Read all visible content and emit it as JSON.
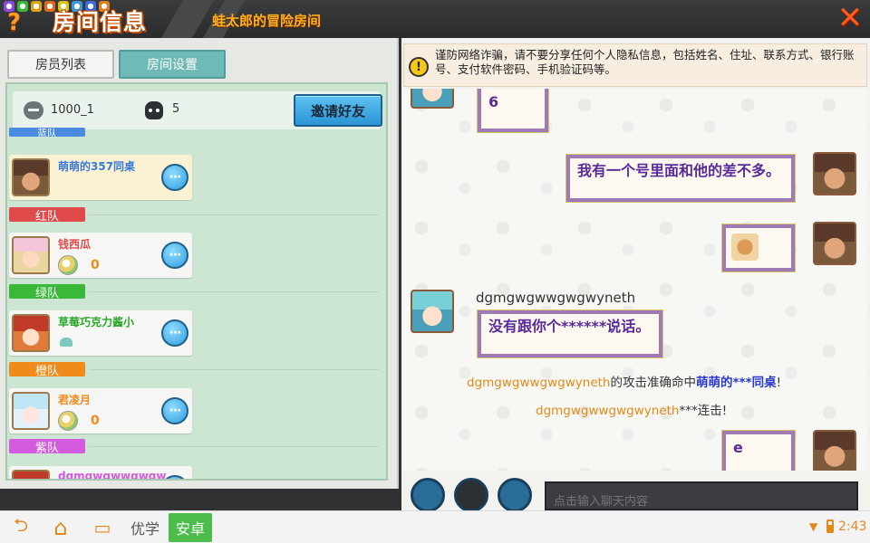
{
  "header": {
    "title": "房间信息",
    "subtitle": "蛙太郎的冒险房间",
    "help_glyph": "?",
    "close_glyph": "✕"
  },
  "tabs": [
    {
      "label": "房员列表",
      "active": true
    },
    {
      "label": "房间设置",
      "active": false
    }
  ],
  "room": {
    "id": "1000_1",
    "player_count": "5",
    "invite_label": "邀请好友"
  },
  "teams": [
    {
      "label": "蓝队",
      "color": "#4a8ae0"
    },
    {
      "label": "红队",
      "color": "#e04a4a"
    },
    {
      "label": "绿队",
      "color": "#3ab83a"
    },
    {
      "label": "橙队",
      "color": "#f08a1a"
    },
    {
      "label": "紫队",
      "color": "#d45ae0"
    }
  ],
  "members": [
    {
      "name": "萌萌的357同桌",
      "name_color": "#3a7ad8",
      "score": "",
      "has_score": false
    },
    {
      "name": "钱西瓜",
      "name_color": "#e04a4a",
      "score": "0",
      "has_score": true
    },
    {
      "name": "草莓巧克力酱小",
      "name_color": "#2aa82a",
      "score": "",
      "has_score": false
    },
    {
      "name": "君凌月",
      "name_color": "#f08a1a",
      "score": "0",
      "has_score": true
    },
    {
      "name": "dgmgwgwwgwgwyneth",
      "name_color": "#d45ae0",
      "score": "",
      "has_score": false
    }
  ],
  "more_glyph": "···",
  "warning": {
    "icon": "!",
    "text": "谨防网络诈骗，请不要分享任何个人隐私信息，包括姓名、住址、联系方式、银行账号、支付软件密码、手机验证码等。"
  },
  "chat": {
    "msg1": "6",
    "msg2": "我有一个号里面和他的差不多。",
    "sender": "dgmgwgwwgwgwyneth",
    "msg3": "没有跟你个******说话。",
    "sys1_player": "dgmgwgwwgwgwyneth",
    "sys1_mid": "的攻击准确命中",
    "sys1_target": "萌萌的***同桌",
    "sys1_end": "!",
    "sys2_player": "dgmgwgwwgwgwyneth",
    "sys2_end": "***连击!",
    "msg4": "e"
  },
  "input": {
    "placeholder": "点击输入聊天内容"
  },
  "navbar": {
    "back_glyph": "⮌",
    "home_glyph": "⌂",
    "recent_glyph": "▭",
    "app1": "优学",
    "app2": "安卓",
    "time": "2:43"
  }
}
